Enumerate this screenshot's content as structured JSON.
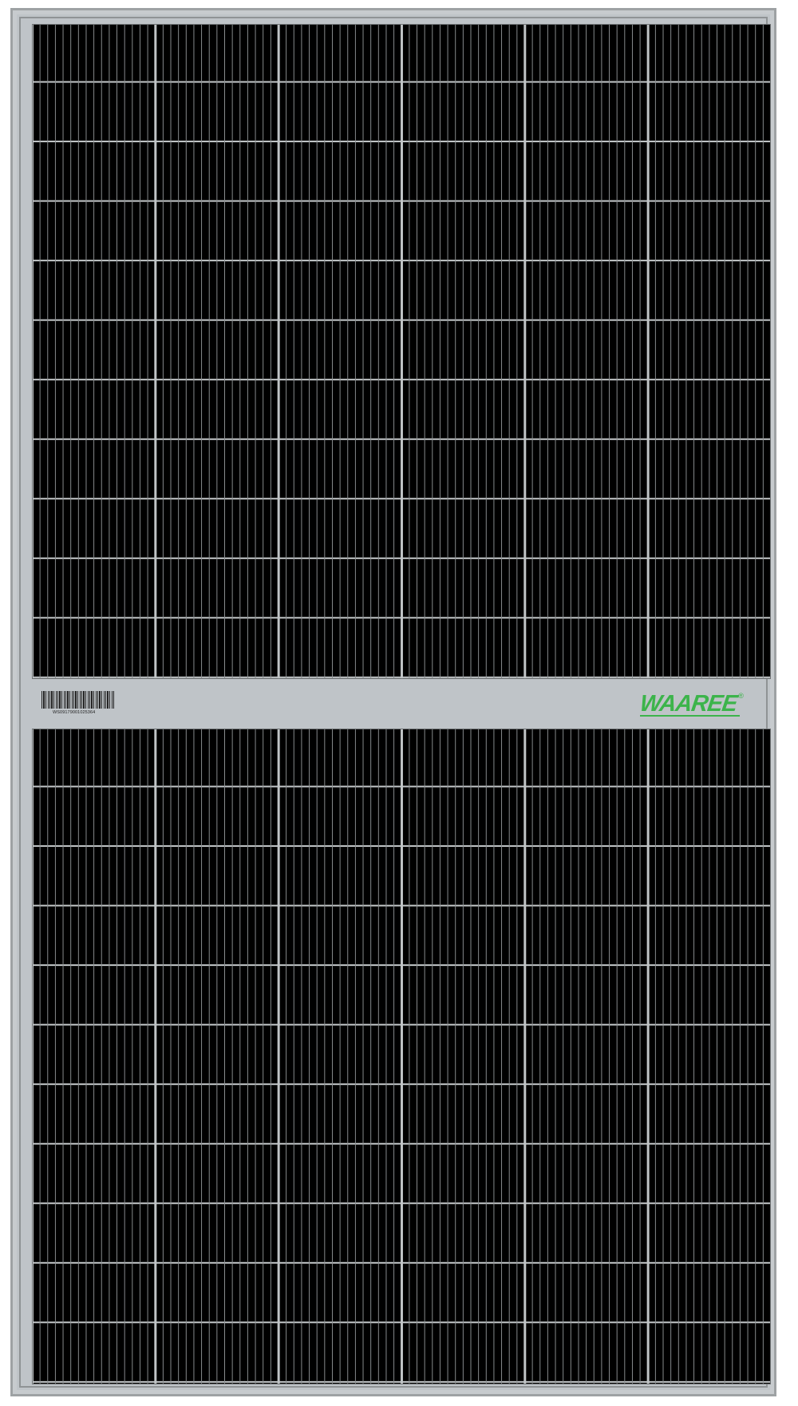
{
  "brand": {
    "name": "WAAREE",
    "registered_mark": "®",
    "color": "#3cb44b"
  },
  "label": {
    "serial": "WS09179001025364"
  },
  "colors": {
    "frame": "#bfc4c8",
    "cells": "#000000"
  }
}
